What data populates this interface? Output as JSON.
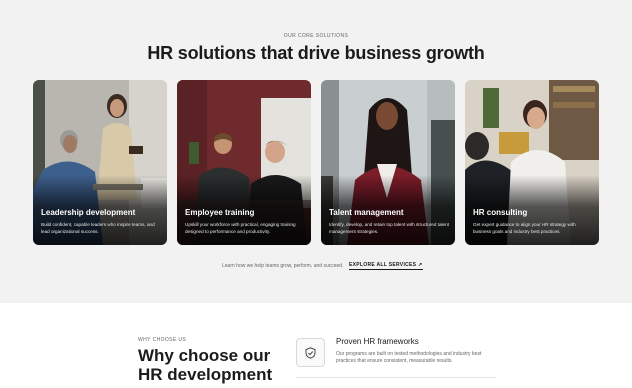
{
  "solutions": {
    "eyebrow": "OUR CORE SOLUTIONS",
    "headline": "HR solutions that drive business growth",
    "cards": [
      {
        "title": "Leadership development",
        "description": "Build confident, capable leaders who inspire teams, and lead organizational success."
      },
      {
        "title": "Employee training",
        "description": "Upskill your workforce with practical, engaging training designed to performance and productivity."
      },
      {
        "title": "Talent management",
        "description": "Identify, develop, and retain top talent with structured talent management strategies."
      },
      {
        "title": "HR consulting",
        "description": "Get expert guidance to align your HR strategy with business goals and industry best practices."
      }
    ],
    "learn_text": "Learn how we help teams grow, perform, and succeed.",
    "explore_label": "EXPLORE ALL SERVICES",
    "explore_arrow": "↗"
  },
  "why": {
    "eyebrow": "WHY CHOOSE US",
    "headline": "Why choose our HR development",
    "feature": {
      "icon": "shield-check-icon",
      "title": "Proven HR frameworks",
      "description": "Our programs are built on tested methodologies and industry best practices that ensure consistent, measurable results."
    }
  },
  "colors": {
    "section_bg": "#f2f2f2",
    "text": "#1b1b1b",
    "muted": "#666666"
  }
}
